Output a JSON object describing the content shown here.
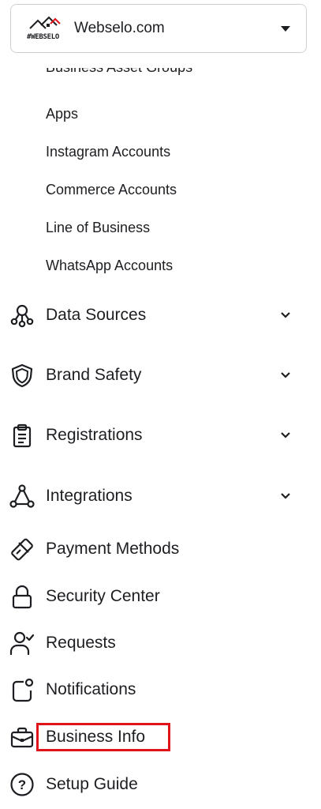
{
  "account": {
    "logo_text": "#WEBSELO",
    "name": "Webselo.com",
    "dropdown_icon": "caret-down-icon"
  },
  "sub_items": [
    {
      "label": "Business Asset Groups"
    },
    {
      "label": "Apps"
    },
    {
      "label": "Instagram Accounts"
    },
    {
      "label": "Commerce Accounts"
    },
    {
      "label": "Line of Business"
    },
    {
      "label": "WhatsApp Accounts"
    }
  ],
  "nav": [
    {
      "label": "Data Sources",
      "icon": "data-sources-icon",
      "expandable": true
    },
    {
      "label": "Brand Safety",
      "icon": "shield-icon",
      "expandable": true
    },
    {
      "label": "Registrations",
      "icon": "clipboard-icon",
      "expandable": true
    },
    {
      "label": "Integrations",
      "icon": "integrations-icon",
      "expandable": true
    },
    {
      "label": "Payment Methods",
      "icon": "credit-card-icon",
      "expandable": false
    },
    {
      "label": "Security Center",
      "icon": "lock-icon",
      "expandable": false
    },
    {
      "label": "Requests",
      "icon": "person-check-icon",
      "expandable": false
    },
    {
      "label": "Notifications",
      "icon": "notification-icon",
      "expandable": false
    },
    {
      "label": "Business Info",
      "icon": "briefcase-icon",
      "expandable": false,
      "highlighted": true
    },
    {
      "label": "Setup Guide",
      "icon": "question-circle-icon",
      "expandable": false
    }
  ],
  "colors": {
    "highlight": "#e0131b",
    "text": "#1c1e21",
    "border": "#ccd0d5"
  }
}
